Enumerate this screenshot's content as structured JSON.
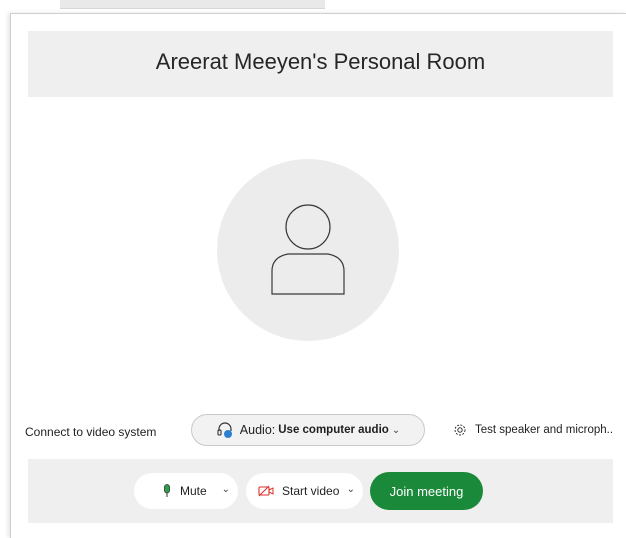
{
  "title": "Areerat Meeyen's Personal Room",
  "options": {
    "connect_label": "Connect to video system",
    "audio_prefix": "Audio:",
    "audio_value": "Use computer audio",
    "test_speaker_label": "Test speaker and microph.."
  },
  "controls": {
    "mute_label": "Mute",
    "video_label": "Start video",
    "join_label": "Join meeting"
  },
  "colors": {
    "join_button": "#1a8a3a",
    "mic_icon": "#2aa24a",
    "video_icon": "#d9322b",
    "headset_badge": "#2f7fd1"
  }
}
